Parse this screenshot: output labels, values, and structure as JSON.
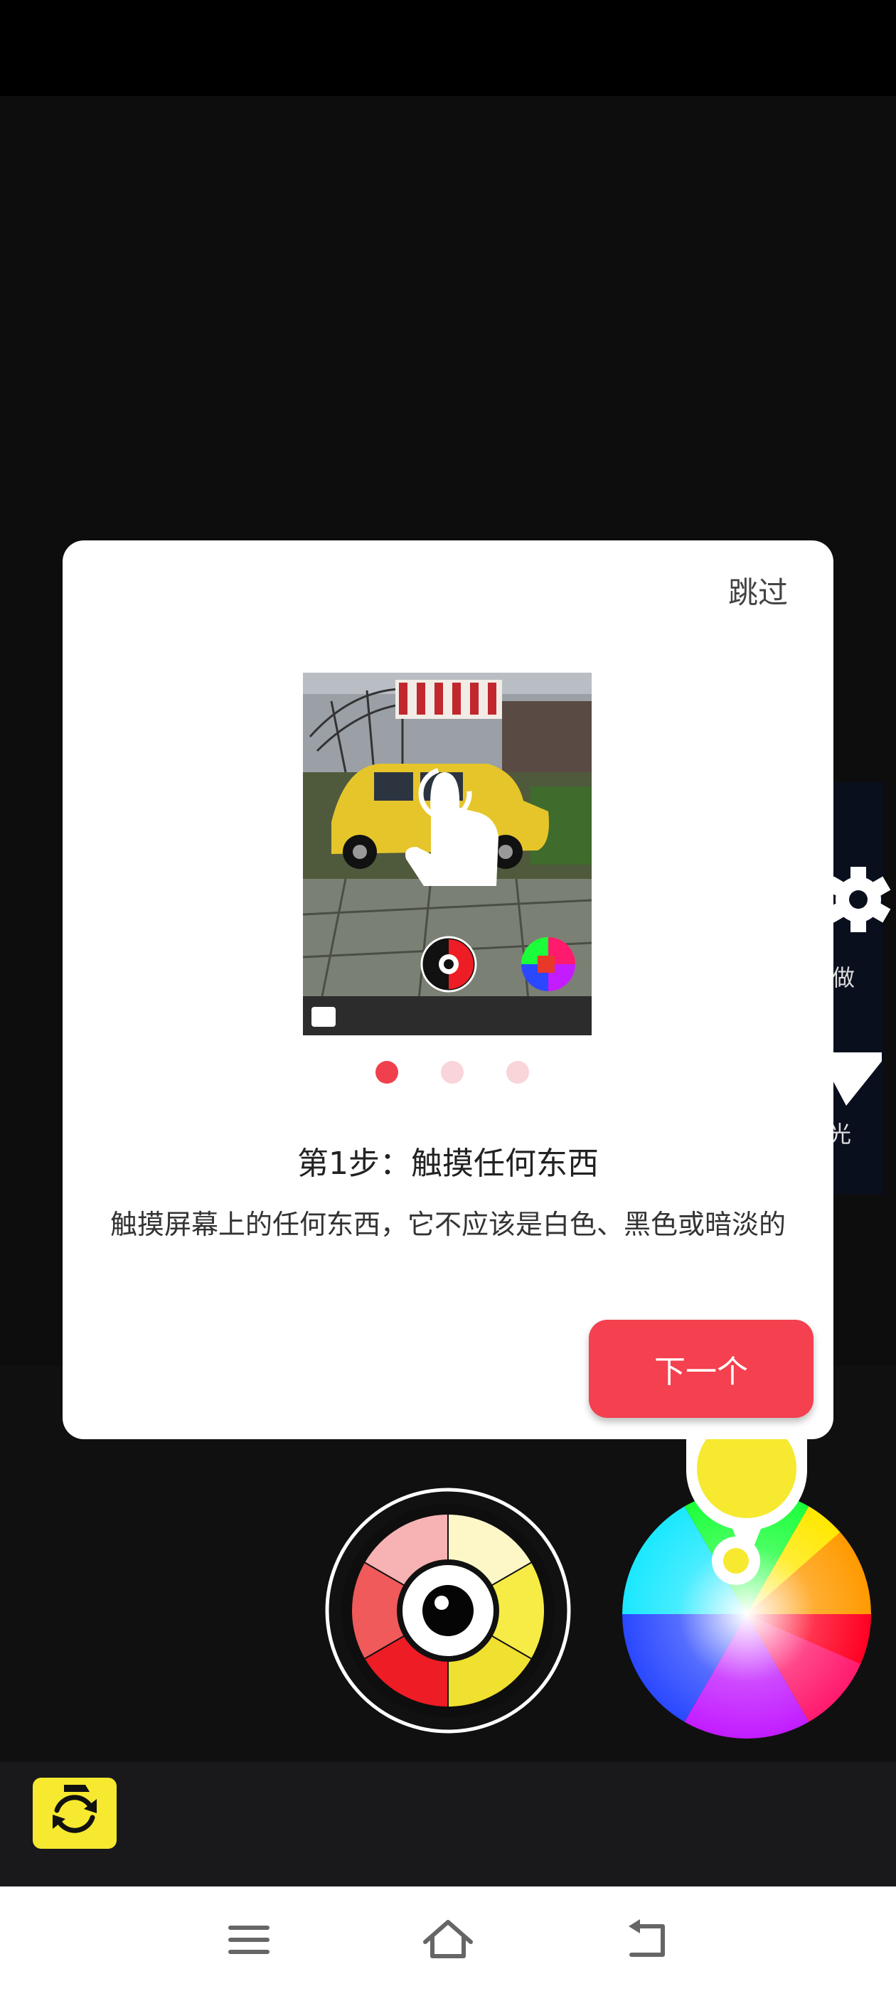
{
  "dialog": {
    "skip_label": "跳过",
    "step_title": "第1步：触摸任何东西",
    "step_description": "触摸屏幕上的任何东西，它不应该是白色、黑色或暗淡的",
    "next_label": "下一个",
    "page_indicator": {
      "current": 1,
      "total": 3
    }
  },
  "side_panel": {
    "partial_label_1": "做",
    "partial_label_2": "光"
  },
  "colors": {
    "accent": "#f4404f",
    "dot_active": "#f0404d",
    "dot_inactive": "#f9d4d8",
    "camera_switch": "#f6e92f",
    "picker_marker": "#f6e92f"
  },
  "icons": {
    "eye_picker": "eye-color-picker-icon",
    "color_wheel": "color-wheel-icon",
    "camera_switch": "camera-switch-icon",
    "settings": "gear-icon",
    "nav_menu": "menu-icon",
    "nav_home": "home-icon",
    "nav_back": "back-icon"
  }
}
